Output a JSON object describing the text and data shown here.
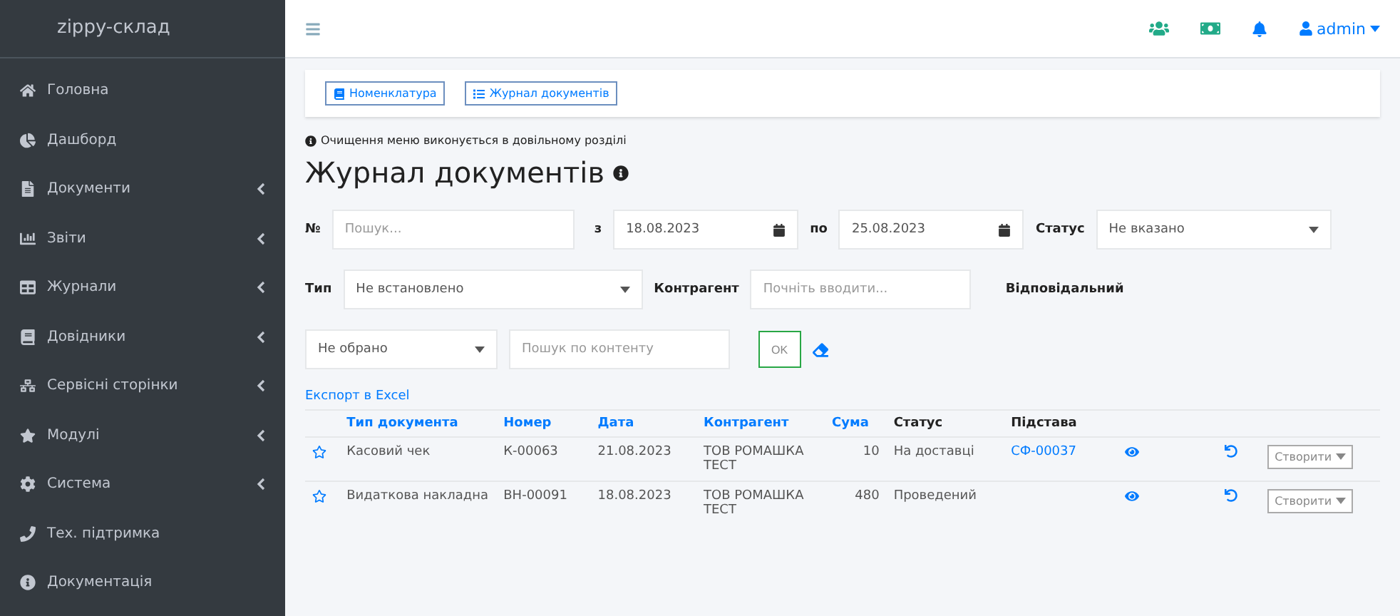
{
  "brand": "zippy-склад",
  "sidebar": {
    "items": [
      {
        "label": "Головна",
        "has_submenu": false
      },
      {
        "label": "Дашборд",
        "has_submenu": false
      },
      {
        "label": "Документи",
        "has_submenu": true
      },
      {
        "label": "Звіти",
        "has_submenu": true
      },
      {
        "label": "Журнали",
        "has_submenu": true
      },
      {
        "label": "Довідники",
        "has_submenu": true
      },
      {
        "label": "Сервісні сторінки",
        "has_submenu": true
      },
      {
        "label": "Модулі",
        "has_submenu": true
      },
      {
        "label": "Система",
        "has_submenu": true
      },
      {
        "label": "Тех. підтримка",
        "has_submenu": false
      },
      {
        "label": "Документація",
        "has_submenu": false
      }
    ]
  },
  "navbar": {
    "user": "admin"
  },
  "toolbar": [
    {
      "label": "Номенклатура"
    },
    {
      "label": "Журнал документів"
    }
  ],
  "notice": "Очищення меню виконується в довільному розділі",
  "title": "Журнал документів",
  "filters": {
    "number_label": "№",
    "number_placeholder": "Пошук...",
    "from_label": "з",
    "from_value": "18.08.2023",
    "to_label": "по",
    "to_value": "25.08.2023",
    "status_label": "Статус",
    "status_value": "Не вказано",
    "type_label": "Тип",
    "type_value": "Не встановлено",
    "contractor_label": "Контрагент",
    "contractor_placeholder": "Почніть вводити...",
    "responsible_label": "Відповідальний",
    "choice_value": "Не обрано",
    "content_placeholder": "Пошук по контенту",
    "ok": "OK"
  },
  "export_link": "Експорт в Excel",
  "table": {
    "columns": [
      "Тип документа",
      "Номер",
      "Дата",
      "Контрагент",
      "Сума",
      "Статус",
      "Підстава"
    ],
    "rows": [
      {
        "type": "Касовий чек",
        "number": "К-00063",
        "date": "21.08.2023",
        "contractor": "ТОВ РОМАШКА ТЕСТ",
        "sum": "10",
        "status": "На доставці",
        "basis": "СФ-00037",
        "create": "Створити"
      },
      {
        "type": "Видаткова накладна",
        "number": "ВН-00091",
        "date": "18.08.2023",
        "contractor": "ТОВ РОМАШКА ТЕСТ",
        "sum": "480",
        "status": "Проведений",
        "create": "Створити"
      }
    ]
  }
}
